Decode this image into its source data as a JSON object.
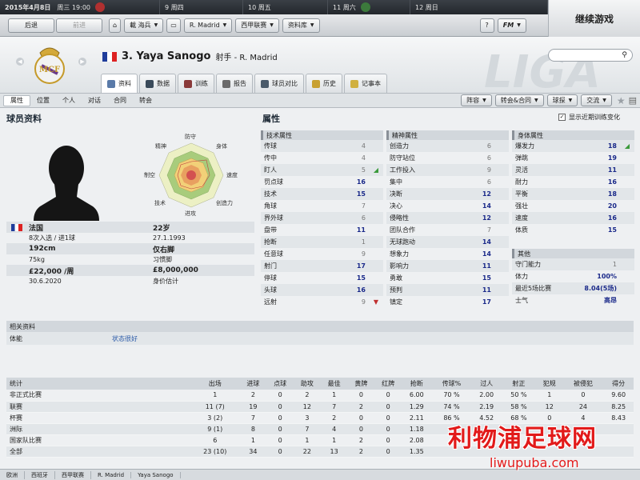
{
  "topbar": {
    "date": "2015年4月8日",
    "weekday": "周三 19:00",
    "days": [
      {
        "num": "9",
        "label": "周四"
      },
      {
        "num": "10",
        "label": "周五"
      },
      {
        "num": "11",
        "label": "周六"
      },
      {
        "num": "12",
        "label": "周日"
      }
    ],
    "continue_label": "继续游戏"
  },
  "toolbar": {
    "back": "后退",
    "forward": "前进",
    "menus": [
      "載 海兵",
      "R. Madrid",
      "西甲联赛",
      "资料库"
    ],
    "help": "?",
    "fm": "FM"
  },
  "player": {
    "number_name": "3. Yaya Sanogo",
    "role": "射手 - R. Madrid"
  },
  "tabs": [
    "资料",
    "数据",
    "训练",
    "报告",
    "球员对比",
    "历史",
    "记事本"
  ],
  "subnav": {
    "items": [
      "属性",
      "位置",
      "个人",
      "对话",
      "合同",
      "转会"
    ],
    "right_buttons": [
      "阵容",
      "转会&合同",
      "球探",
      "交流"
    ]
  },
  "profile": {
    "title": "球员资料",
    "radar_labels": [
      "防守",
      "身体",
      "速度",
      "创造力",
      "进攻",
      "技术",
      "制空",
      "精神"
    ],
    "info": [
      {
        "left": "法国",
        "right": "22岁"
      },
      {
        "left": "8次入选 / 进1球",
        "right": "27.1.1993"
      },
      {
        "left": "192cm",
        "right": "仅右脚"
      },
      {
        "left": "75kg",
        "right": "习惯脚"
      },
      {
        "left": "£22,000 /周",
        "right": "£8,000,000"
      },
      {
        "left": "30.6.2020",
        "right": "身价估计"
      }
    ]
  },
  "attributes": {
    "title": "属性",
    "show_training": "显示近期训练变化",
    "technical": {
      "header": "技术属性",
      "items": [
        {
          "name": "传球",
          "value": "4",
          "mark": ""
        },
        {
          "name": "传中",
          "value": "4",
          "mark": ""
        },
        {
          "name": "盯人",
          "value": "5",
          "mark": "up"
        },
        {
          "name": "罚点球",
          "value": "16",
          "mark": ""
        },
        {
          "name": "技术",
          "value": "15",
          "mark": ""
        },
        {
          "name": "角球",
          "value": "7",
          "mark": ""
        },
        {
          "name": "界外球",
          "value": "6",
          "mark": ""
        },
        {
          "name": "盘带",
          "value": "11",
          "mark": ""
        },
        {
          "name": "抢断",
          "value": "1",
          "mark": ""
        },
        {
          "name": "任意球",
          "value": "9",
          "mark": ""
        },
        {
          "name": "射门",
          "value": "17",
          "mark": ""
        },
        {
          "name": "停球",
          "value": "15",
          "mark": ""
        },
        {
          "name": "头球",
          "value": "16",
          "mark": ""
        },
        {
          "name": "远射",
          "value": "9",
          "mark": "down"
        }
      ]
    },
    "mental": {
      "header": "精神属性",
      "items": [
        {
          "name": "创造力",
          "value": "6"
        },
        {
          "name": "防守站位",
          "value": "6"
        },
        {
          "name": "工作投入",
          "value": "9"
        },
        {
          "name": "集中",
          "value": "6"
        },
        {
          "name": "决断",
          "value": "12"
        },
        {
          "name": "决心",
          "value": "14"
        },
        {
          "name": "侵略性",
          "value": "12"
        },
        {
          "name": "团队合作",
          "value": "7"
        },
        {
          "name": "无球跑动",
          "value": "14"
        },
        {
          "name": "想象力",
          "value": "14"
        },
        {
          "name": "影响力",
          "value": "11"
        },
        {
          "name": "勇敢",
          "value": "15"
        },
        {
          "name": "预判",
          "value": "11"
        },
        {
          "name": "镇定",
          "value": "17"
        }
      ]
    },
    "physical": {
      "header": "身体属性",
      "items": [
        {
          "name": "爆发力",
          "value": "18",
          "mark": "up"
        },
        {
          "name": "弹跳",
          "value": "19",
          "mark": ""
        },
        {
          "name": "灵活",
          "value": "11",
          "mark": ""
        },
        {
          "name": "耐力",
          "value": "16",
          "mark": ""
        },
        {
          "name": "平衡",
          "value": "18",
          "mark": ""
        },
        {
          "name": "强壮",
          "value": "20",
          "mark": ""
        },
        {
          "name": "速度",
          "value": "16",
          "mark": ""
        },
        {
          "name": "体质",
          "value": "15",
          "mark": ""
        }
      ]
    },
    "other": {
      "header": "其他",
      "items": [
        {
          "name": "守门能力",
          "value": "1"
        },
        {
          "name": "体力",
          "value": "100%"
        },
        {
          "name": "最近5场比赛",
          "value": "8.04(5场)"
        },
        {
          "name": "士气",
          "value": "高昂"
        }
      ]
    }
  },
  "related": {
    "header": "相关资料",
    "label": "体能",
    "value": "状态很好"
  },
  "stats": {
    "headers": [
      "统计",
      "出场",
      "进球",
      "点球",
      "助攻",
      "最佳",
      "黄牌",
      "红牌",
      "抢断",
      "传球%",
      "过人",
      "射正",
      "犯规",
      "被侵犯",
      "得分"
    ],
    "rows": [
      [
        "非正式比赛",
        "1",
        "2",
        "0",
        "2",
        "1",
        "0",
        "0",
        "6.00",
        "70 %",
        "2.00",
        "50 %",
        "1",
        "0",
        "9.60"
      ],
      [
        "联赛",
        "11 (7)",
        "19",
        "0",
        "12",
        "7",
        "2",
        "0",
        "1.29",
        "74 %",
        "2.19",
        "58 %",
        "12",
        "24",
        "8.25"
      ],
      [
        "杯赛",
        "3 (2)",
        "7",
        "0",
        "3",
        "2",
        "0",
        "0",
        "2.11",
        "86 %",
        "4.52",
        "68 %",
        "0",
        "4",
        "8.43"
      ],
      [
        "洲际",
        "9 (1)",
        "8",
        "0",
        "7",
        "4",
        "0",
        "0",
        "1.18",
        "",
        "",
        "",
        "",
        "",
        ""
      ],
      [
        "国家队比赛",
        "6",
        "1",
        "0",
        "1",
        "1",
        "2",
        "0",
        "2.08",
        "",
        "",
        "",
        "",
        "",
        ""
      ],
      [
        "全部",
        "23 (10)",
        "34",
        "0",
        "22",
        "13",
        "2",
        "0",
        "1.35",
        "",
        "",
        "",
        "",
        "",
        ""
      ]
    ]
  },
  "breadcrumbs": [
    "欧洲",
    "西班牙",
    "西甲联赛",
    "R. Madrid",
    "Yaya Sanogo"
  ],
  "watermark": {
    "title": "利物浦足球网",
    "url": "liwupuba.com"
  }
}
